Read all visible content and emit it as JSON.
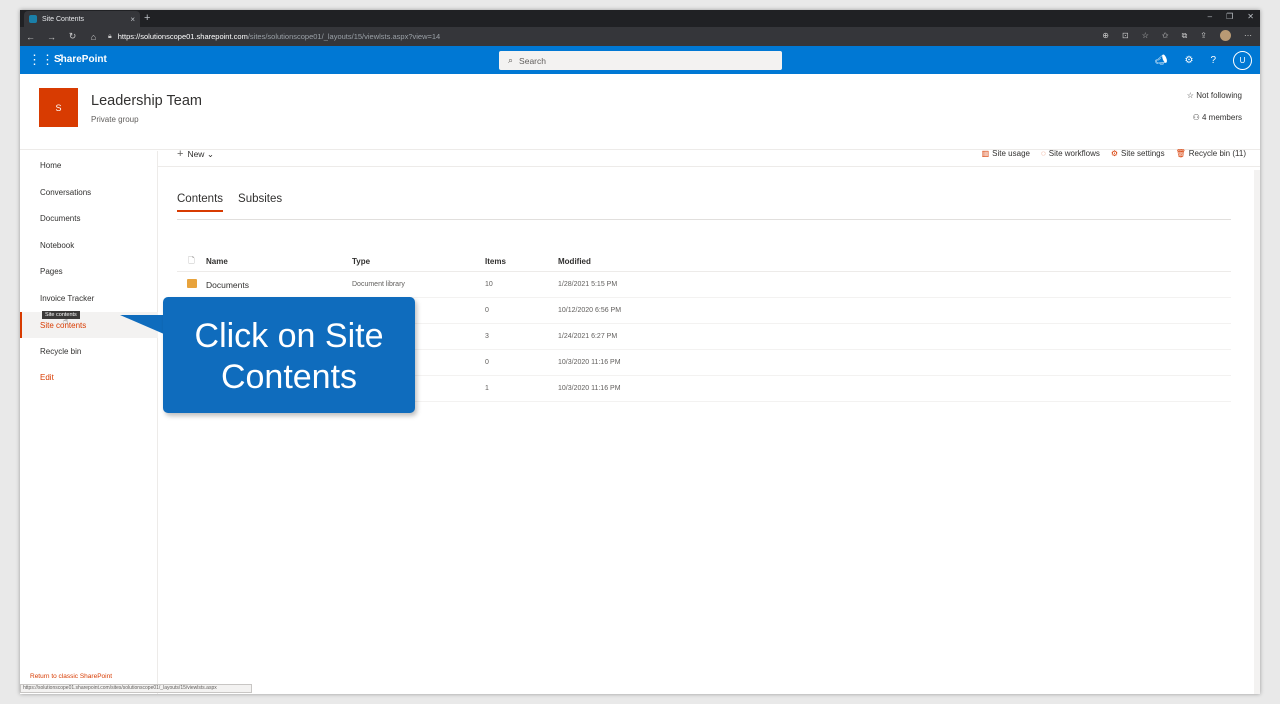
{
  "browser": {
    "tab_title": "Site Contents",
    "tab_close": "×",
    "new_tab": "+",
    "url_host": "https://solutionscope01.sharepoint.com",
    "url_rest": "/sites/solutionscope01/_layouts/15/viewlsts.aspx?view=14",
    "status_url": "https://solutionscope01.sharepoint.com/sites/solutionscope01/_layouts/15/viewlsts.aspx"
  },
  "suite": {
    "brand": "SharePoint",
    "search_placeholder": "Search",
    "avatar_letter": "U"
  },
  "site": {
    "logo_letter": "S",
    "title": "Leadership Team",
    "subtitle": "Private group",
    "follow": "Not following",
    "members": "4 members"
  },
  "nav": {
    "items": [
      "Home",
      "Conversations",
      "Documents",
      "Notebook",
      "Pages",
      "Invoice Tracker",
      "Site contents",
      "Recycle bin"
    ],
    "edit": "Edit",
    "tooltip": "Site contents",
    "return_classic": "Return to classic SharePoint"
  },
  "command_bar": {
    "new_label": "New",
    "site_usage": "Site usage",
    "site_workflows": "Site workflows",
    "site_settings": "Site settings",
    "recycle_bin": "Recycle bin (11)"
  },
  "pivot": {
    "contents": "Contents",
    "subsites": "Subsites"
  },
  "list": {
    "headers": {
      "name": "Name",
      "type": "Type",
      "items": "Items",
      "modified": "Modified"
    },
    "rows": [
      {
        "name": "Documents",
        "type": "Document library",
        "items": "10",
        "modified": "1/28/2021 5:15 PM"
      },
      {
        "name": "",
        "type": "",
        "items": "0",
        "modified": "10/12/2020 6:56 PM"
      },
      {
        "name": "",
        "type": "",
        "items": "3",
        "modified": "1/24/2021 6:27 PM"
      },
      {
        "name": "",
        "type": "",
        "items": "0",
        "modified": "10/3/2020 11:16 PM"
      },
      {
        "name": "",
        "type": "",
        "items": "1",
        "modified": "10/3/2020 11:16 PM"
      }
    ]
  },
  "callout": {
    "text": "Click on Site\nContents"
  },
  "colors": {
    "suite_blue": "#0078d4",
    "accent_orange": "#d83b01",
    "callout_blue": "#0f6cbd"
  }
}
